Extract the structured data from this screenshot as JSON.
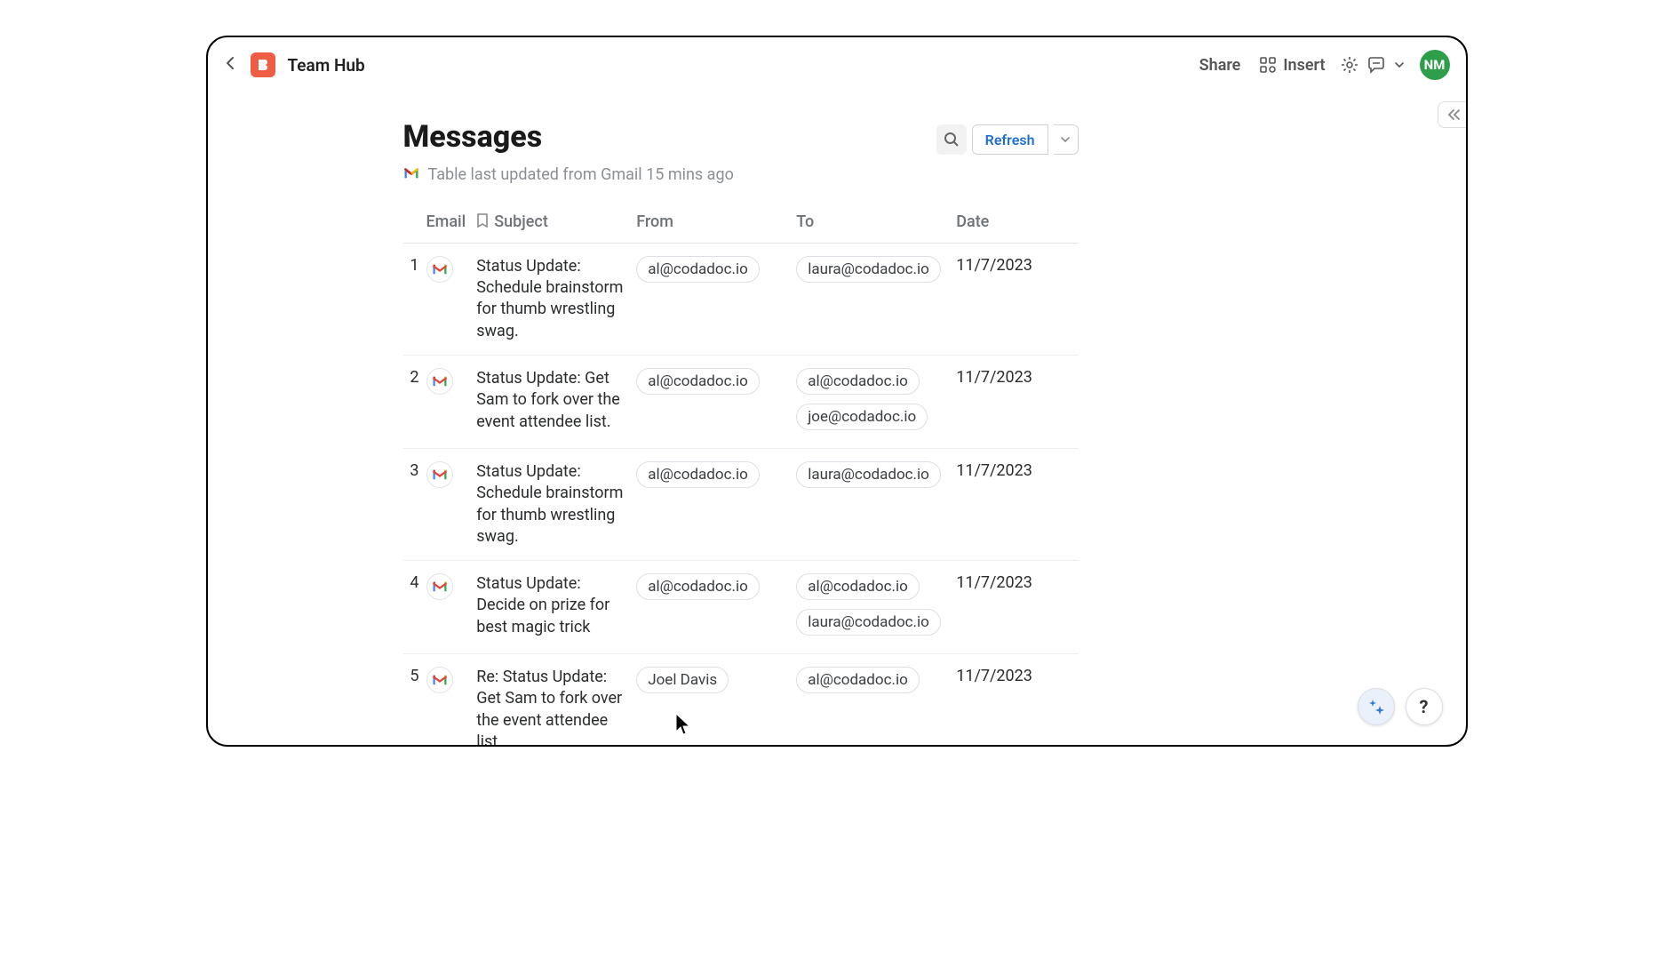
{
  "doc_title": "Team Hub",
  "header": {
    "share": "Share",
    "insert": "Insert",
    "avatar_initials": "NM"
  },
  "page": {
    "title": "Messages",
    "refresh_label": "Refresh",
    "sync_text": "Table last updated from Gmail 15 mins ago"
  },
  "table": {
    "columns": {
      "email": "Email",
      "subject": "Subject",
      "from": "From",
      "to": "To",
      "date": "Date"
    },
    "rows": [
      {
        "n": "1",
        "subject": "Status Update: Schedule brainstorm for thumb wrestling swag.",
        "from": [
          "al@codadoc.io"
        ],
        "to": [
          "laura@codadoc.io"
        ],
        "date": "11/7/2023"
      },
      {
        "n": "2",
        "subject": "Status Update: Get Sam to fork over the event attendee list.",
        "from": [
          "al@codadoc.io"
        ],
        "to": [
          "al@codadoc.io",
          "joe@codadoc.io"
        ],
        "date": "11/7/2023"
      },
      {
        "n": "3",
        "subject": "Status Update: Schedule brainstorm for thumb wrestling swag.",
        "from": [
          "al@codadoc.io"
        ],
        "to": [
          "laura@codadoc.io"
        ],
        "date": "11/7/2023"
      },
      {
        "n": "4",
        "subject": "Status Update: Decide on prize for best magic trick",
        "from": [
          "al@codadoc.io"
        ],
        "to": [
          "al@codadoc.io",
          "laura@codadoc.io"
        ],
        "date": "11/7/2023"
      },
      {
        "n": "5",
        "subject": "Re: Status Update: Get Sam to fork over the event attendee list.",
        "from": [
          "Joel Davis"
        ],
        "to": [
          "al@codadoc.io"
        ],
        "date": "11/7/2023"
      }
    ]
  },
  "help_label": "?"
}
